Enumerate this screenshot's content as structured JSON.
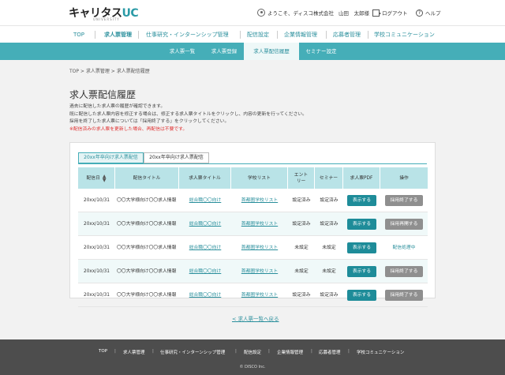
{
  "header": {
    "logo_main": "キャリタス",
    "logo_uc": "UC",
    "logo_sub": "UNIVERSITY",
    "greeting": "ようこそ、ディスコ株式会社",
    "user_name": "山田　太郎様",
    "logout": "ログアウト",
    "help": "ヘルプ"
  },
  "mainnav": {
    "items": [
      "TOP",
      "求人票管理",
      "仕事研究・インターンシップ管理",
      "配信設定",
      "企業情報管理",
      "応募者管理",
      "学校コミュニケーション"
    ]
  },
  "subnav": {
    "items": [
      "求人票一覧",
      "求人票登録",
      "求人票配信履歴",
      "セミナー設定"
    ]
  },
  "breadcrumb": "TOP > 求人票管理 > 求人票配信履歴",
  "page_title": "求人票配信履歴",
  "description": {
    "line1": "過去に配信した求人票の履歴が確認できます。",
    "line2": "既に配信した求人票内容を修正する場合は、修正する求人票タイトルをクリックし、内容の更新を行ってください。",
    "line3": "採用を終了した求人票については「採用終了する」をクリックしてください。",
    "warning": "※配信済みの求人票を更新した場合、再配信は不要です。"
  },
  "tabs": [
    "20xx年卒向け求人票配信",
    "20xx年卒向け求人票配信"
  ],
  "table": {
    "headers": [
      "配信日",
      "配信タイトル",
      "求人票タイトル",
      "学校リスト",
      "エントリー",
      "セミナー",
      "求人票PDF",
      "操作"
    ],
    "rows": [
      {
        "date": "20xx/10/31",
        "title": "〇〇大学様向け〇〇求人情報",
        "job": "総合職〇〇向け",
        "list": "首都圏学校リスト",
        "entry": "設定済み",
        "seminar": "設定済み",
        "pdf": "表示する",
        "action": "採用終了する",
        "action_type": "button"
      },
      {
        "date": "20xx/10/31",
        "title": "〇〇大学様向け〇〇求人情報",
        "job": "総合職〇〇向け",
        "list": "首都圏学校リスト",
        "entry": "設定済み",
        "seminar": "設定済み",
        "pdf": "表示する",
        "action": "採用再開する",
        "action_type": "button"
      },
      {
        "date": "20xx/10/31",
        "title": "〇〇大学様向け〇〇求人情報",
        "job": "総合職〇〇向け",
        "list": "首都圏学校リスト",
        "entry": "未設定",
        "seminar": "未設定",
        "pdf": "表示する",
        "action": "配信処理中",
        "action_type": "text"
      },
      {
        "date": "20xx/10/31",
        "title": "〇〇大学様向け〇〇求人情報",
        "job": "総合職〇〇向け",
        "list": "首都圏学校リスト",
        "entry": "未設定",
        "seminar": "未設定",
        "pdf": "表示する",
        "action": "採用終了する",
        "action_type": "button"
      },
      {
        "date": "20xx/10/31",
        "title": "〇〇大学様向け〇〇求人情報",
        "job": "総合職〇〇向け",
        "list": "首都圏学校リスト",
        "entry": "設定済み",
        "seminar": "設定済み",
        "pdf": "表示する",
        "action": "採用終了する",
        "action_type": "button"
      }
    ]
  },
  "back_link": "< 求人票一覧へ戻る",
  "footer": {
    "items": [
      "TOP",
      "求人票管理",
      "仕事研究・インターンシップ管理",
      "配信設定",
      "企業情報管理",
      "応募者管理",
      "学校コミュニケーション"
    ],
    "copyright": "© DISCO Inc."
  },
  "colors": {
    "accent": "#45aeb8",
    "primary_button": "#1e8c99",
    "disabled_button": "#8f8f8f",
    "warning": "#e03030"
  }
}
